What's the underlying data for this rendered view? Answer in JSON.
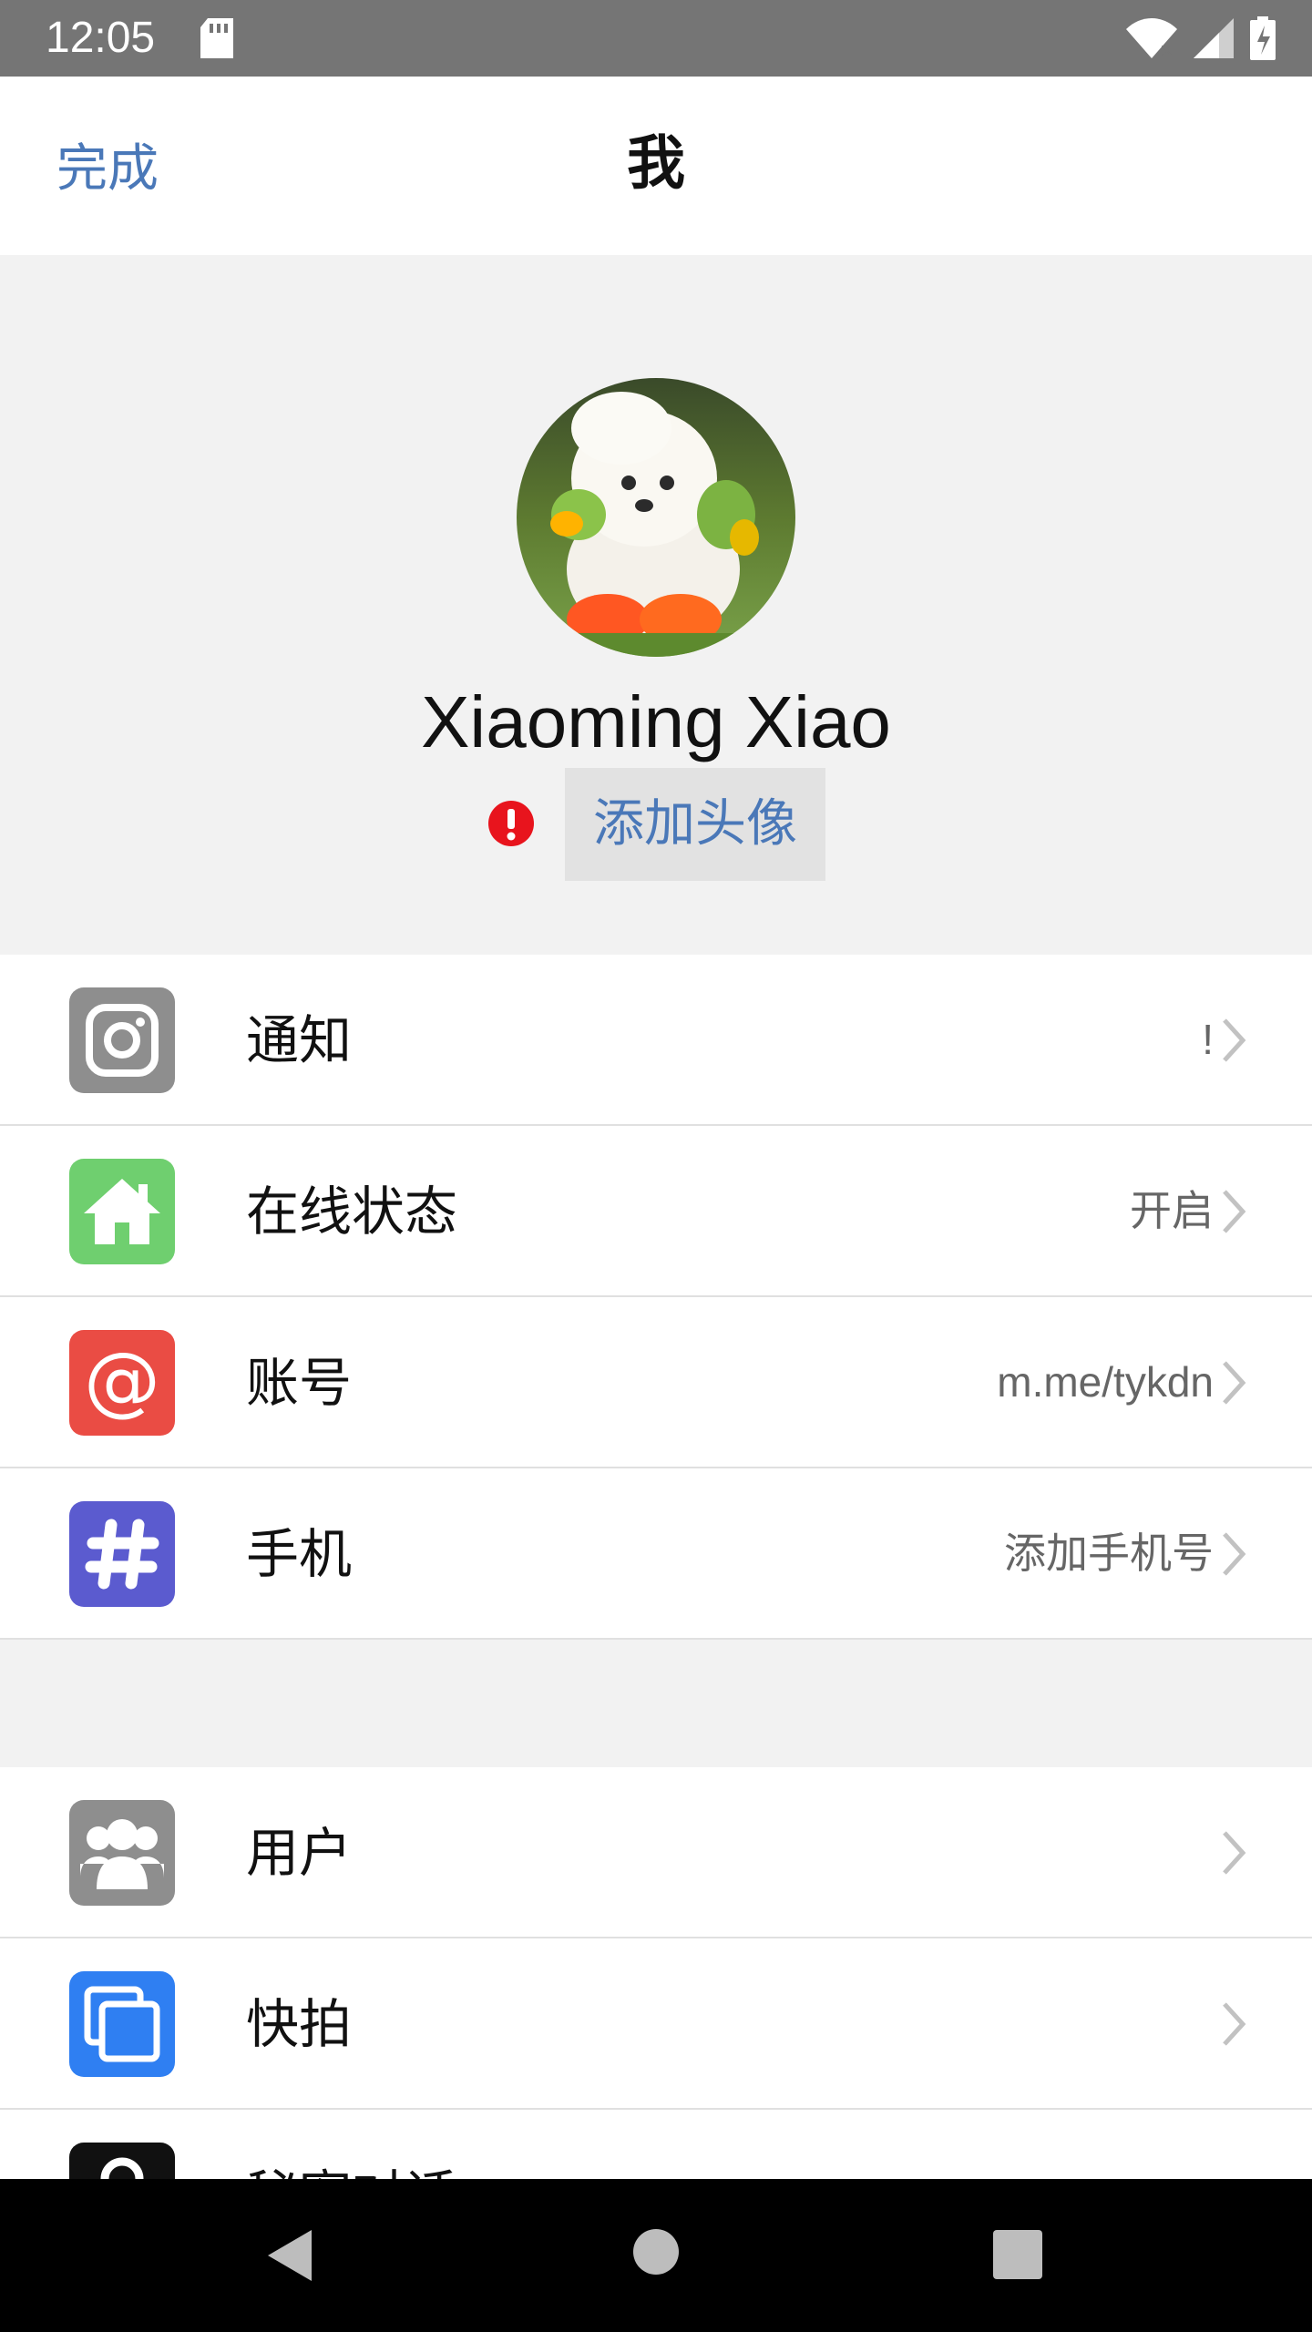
{
  "status_bar": {
    "time": "12:05"
  },
  "nav": {
    "done_label": "完成",
    "title": "我"
  },
  "profile": {
    "name": "Xiaoming Xiao",
    "add_avatar_label": "添加头像"
  },
  "settings_group_1": [
    {
      "icon": "instagram-camera-icon",
      "color": "#8e8e8e",
      "label": "通知",
      "value": "!"
    },
    {
      "icon": "home-icon",
      "color": "#6fcf6f",
      "label": "在线状态",
      "value": "开启"
    },
    {
      "icon": "at-sign-icon",
      "color": "#ea4c44",
      "label": "账号",
      "value": "m.me/tykdn"
    },
    {
      "icon": "hashtag-icon",
      "color": "#5b5bcf",
      "label": "手机",
      "value": "添加手机号"
    }
  ],
  "settings_group_2": [
    {
      "icon": "users-icon",
      "color": "#8e8e8e",
      "label": "用户",
      "value": ""
    },
    {
      "icon": "copy-icon",
      "color": "#2f7ff2",
      "label": "快拍",
      "value": ""
    },
    {
      "icon": "lock-icon",
      "color": "#111111",
      "label": "秘密对话",
      "value": ""
    }
  ]
}
